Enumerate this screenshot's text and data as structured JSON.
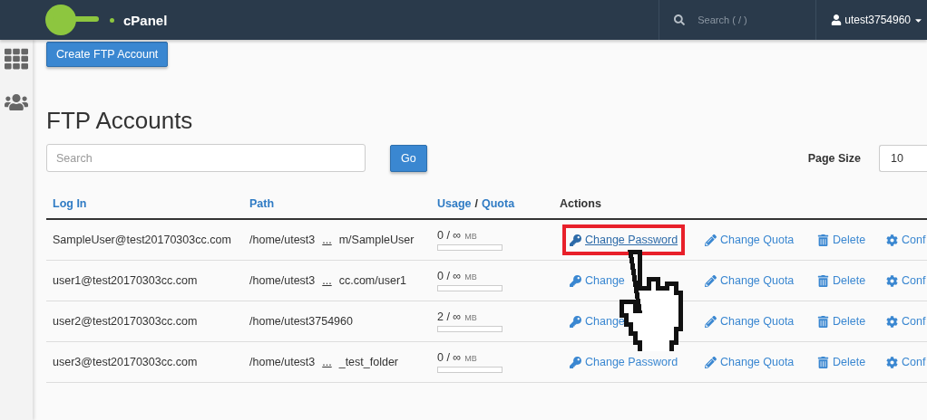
{
  "header": {
    "brand": "cPanel",
    "search": {
      "placeholder": "Search ( / )"
    },
    "user": "utest3754960"
  },
  "sidebar": {
    "items": [
      {
        "kind": "grid",
        "selected": false
      },
      {
        "kind": "users",
        "selected": false
      }
    ]
  },
  "create_button": "Create FTP Account",
  "title": "FTP Accounts",
  "search": {
    "placeholder": "Search",
    "button": "Go"
  },
  "page_size": {
    "label": "Page Size",
    "value": "10"
  },
  "table": {
    "columns": [
      {
        "kind": "sort",
        "parts": [
          "Log In"
        ]
      },
      {
        "kind": "sort",
        "parts": [
          "Path"
        ]
      },
      {
        "kind": "sort",
        "parts": [
          "Usage",
          "/",
          "Quota"
        ]
      },
      {
        "kind": "plain",
        "parts": [
          "Actions"
        ]
      }
    ],
    "rows": [
      {
        "login": "SampleUser@test20170303cc.com",
        "path_head": "/home/utest3",
        "path_ellipsis": "...",
        "path_tail": "m/SampleUser",
        "usage": "0 / ∞",
        "unit": "MB",
        "level": 0,
        "actions": [
          {
            "kind": "key",
            "label": "Change Password",
            "highlighted": true
          },
          {
            "kind": "pencil",
            "label": "Change Quota",
            "highlighted": false
          },
          {
            "kind": "trash",
            "label": "Delete",
            "highlighted": false
          },
          {
            "kind": "gear",
            "label": "Conf",
            "highlighted": false
          }
        ]
      },
      {
        "login": "user1@test20170303cc.com",
        "path_head": "/home/utest3",
        "path_ellipsis": "...",
        "path_tail": "cc.com/user1",
        "usage": "0 / ∞",
        "unit": "MB",
        "level": 0,
        "actions": [
          {
            "kind": "key",
            "label": "Change",
            "highlighted": false
          },
          {
            "kind": "pencil",
            "label": "Change Quota",
            "highlighted": false
          },
          {
            "kind": "trash",
            "label": "Delete",
            "highlighted": false
          },
          {
            "kind": "gear",
            "label": "Conf",
            "highlighted": false
          }
        ]
      },
      {
        "login": "user2@test20170303cc.com",
        "path_head": "/home/utest3754960",
        "usage": "2 / ∞",
        "unit": "MB",
        "level": 0,
        "actions": [
          {
            "kind": "key",
            "label": "Change",
            "highlighted": false
          },
          {
            "kind": "pencil",
            "label": "Change Quota",
            "highlighted": false
          },
          {
            "kind": "trash",
            "label": "Delete",
            "highlighted": false
          },
          {
            "kind": "gear",
            "label": "Conf",
            "highlighted": false
          }
        ]
      },
      {
        "login": "user3@test20170303cc.com",
        "path_head": "/home/utest3",
        "path_ellipsis": "...",
        "path_tail": "_test_folder",
        "usage": "0 / ∞",
        "unit": "MB",
        "level": 0,
        "actions": [
          {
            "kind": "key",
            "label": "Change Password",
            "highlighted": false
          },
          {
            "kind": "pencil",
            "label": "Change Quota",
            "highlighted": false
          },
          {
            "kind": "trash",
            "label": "Delete",
            "highlighted": false
          },
          {
            "kind": "gear",
            "label": "Conf",
            "highlighted": false
          }
        ]
      }
    ]
  }
}
